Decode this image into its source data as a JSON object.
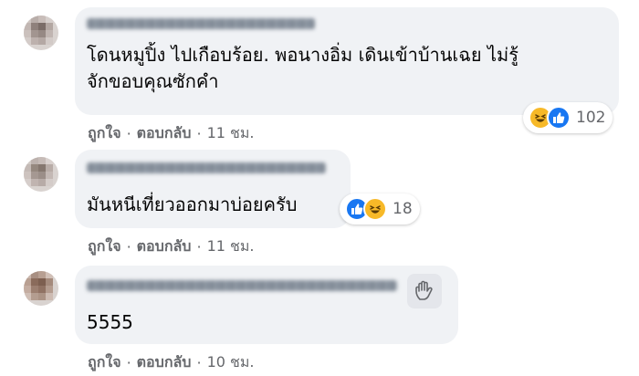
{
  "comments": [
    {
      "text": "โดนหมูปิ้ง ไปเกือบร้อย. พอนางอิ่ม เดินเข้าบ้านเฉย ไม่รู้\nจักขอบคุณซักคำ",
      "reactions": {
        "icons": [
          "haha-icon",
          "like-icon"
        ],
        "count": "102"
      },
      "actions": {
        "like": "ถูกใจ",
        "reply": "ตอบกลับ",
        "separator": "·",
        "time": "11 ชม."
      }
    },
    {
      "text": "มันหนีเที่ยวออกมาบ่อยครับ",
      "reactions": {
        "icons": [
          "like-icon",
          "haha-icon"
        ],
        "count": "18"
      },
      "actions": {
        "like": "ถูกใจ",
        "reply": "ตอบกลับ",
        "separator": "·",
        "time": "11 ชม."
      }
    },
    {
      "text": "5555",
      "actions": {
        "like": "ถูกใจ",
        "reply": "ตอบกลับ",
        "separator": "·",
        "time": "10 ชม."
      }
    }
  ],
  "colors": {
    "bubble": "#f0f2f5",
    "text": "#050505",
    "meta": "#65676b",
    "like": "#1877f2",
    "haha": "#f7b928"
  }
}
